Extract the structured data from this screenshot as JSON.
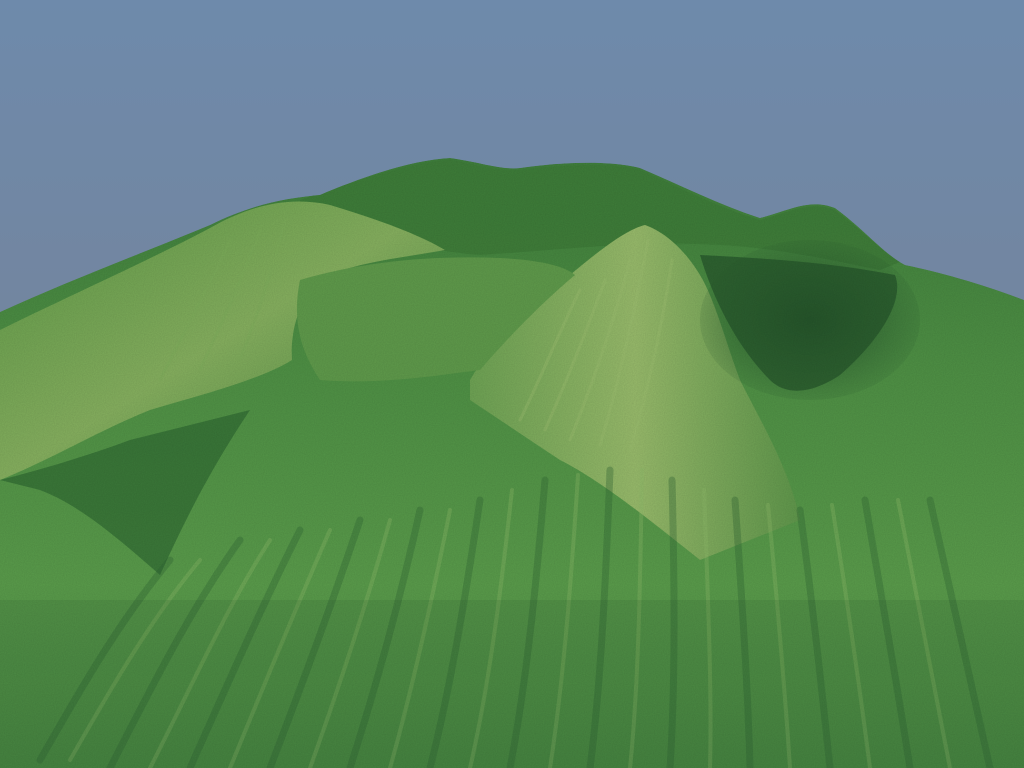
{
  "scene": {
    "subject": "terrain",
    "colors": {
      "sky_top": "#6e8aab",
      "sky_horizon": "#7f7f8c",
      "terrain_light": "#8fb66a",
      "terrain_mid": "#5f9b4c",
      "terrain_dark": "#2f6a32",
      "terrain_shadow": "#214f2a"
    }
  }
}
